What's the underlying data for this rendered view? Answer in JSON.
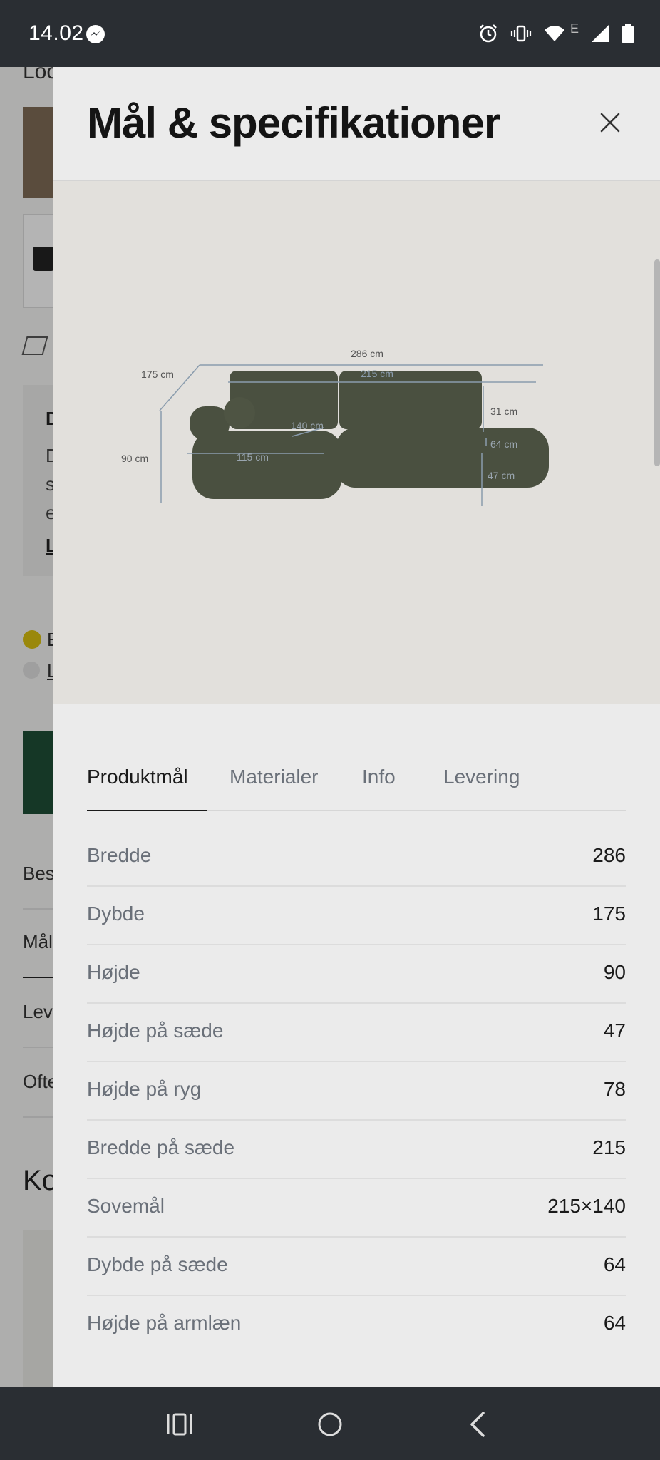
{
  "status_bar": {
    "time": "14.02",
    "icons": [
      "messenger-icon",
      "alarm-icon",
      "vibrate-icon",
      "wifi-icon",
      "signal-icon",
      "battery-icon"
    ],
    "network_label": "E"
  },
  "background_page": {
    "partial_texts": [
      "Loc",
      "D",
      "D",
      "s",
      "e",
      "L",
      "E",
      "L",
      "Bes",
      "Mål",
      "Lev",
      "Ofte",
      "Ko"
    ]
  },
  "modal": {
    "title": "Mål & specifikationer",
    "close_icon": "close-icon",
    "diagram": {
      "product_color": "#4a5040",
      "labels": {
        "total_width": "286 cm",
        "seat_width": "215 cm",
        "depth": "175 cm",
        "height": "90 cm",
        "chaise_depth": "140 cm",
        "chaise_width": "115 cm",
        "back_height": "31 cm",
        "seat_depth": "64 cm",
        "seat_height": "47 cm"
      }
    },
    "tabs": [
      {
        "label": "Produktmål",
        "active": true
      },
      {
        "label": "Materialer",
        "active": false
      },
      {
        "label": "Info",
        "active": false
      },
      {
        "label": "Levering",
        "active": false
      }
    ],
    "specs": [
      {
        "label": "Bredde",
        "value": "286"
      },
      {
        "label": "Dybde",
        "value": "175"
      },
      {
        "label": "Højde",
        "value": "90"
      },
      {
        "label": "Højde på sæde",
        "value": "47"
      },
      {
        "label": "Højde på ryg",
        "value": "78"
      },
      {
        "label": "Bredde på sæde",
        "value": "215"
      },
      {
        "label": "Sovemål",
        "value": "215×140"
      },
      {
        "label": "Dybde på sæde",
        "value": "64"
      },
      {
        "label": "Højde på armlæn",
        "value": "64"
      }
    ]
  },
  "nav_bar": {
    "buttons": [
      "recent-apps-icon",
      "home-icon",
      "back-icon"
    ]
  },
  "colors": {
    "accent_green": "#1e4d35",
    "badge_yellow": "#d6bd10"
  }
}
